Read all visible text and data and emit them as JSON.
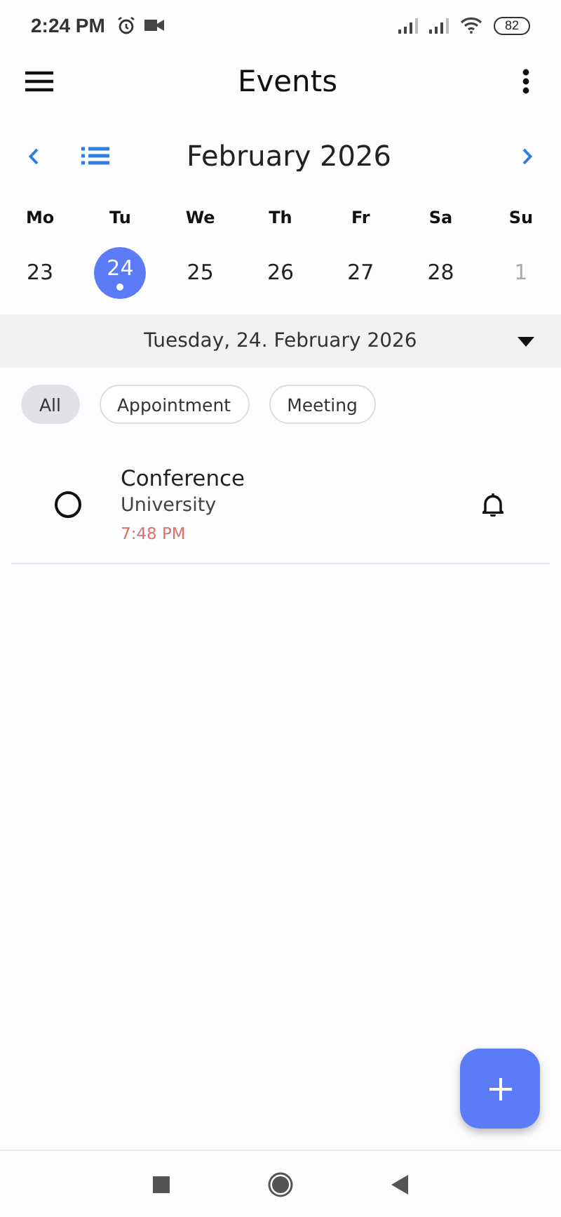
{
  "status_bar": {
    "time": "2:24 PM",
    "battery": "82"
  },
  "header": {
    "title": "Events"
  },
  "month": {
    "title": "February 2026"
  },
  "weekdays": [
    "Mo",
    "Tu",
    "We",
    "Th",
    "Fr",
    "Sa",
    "Su"
  ],
  "days": [
    {
      "label": "23",
      "selected": false,
      "muted": false,
      "has_event": false
    },
    {
      "label": "24",
      "selected": true,
      "muted": false,
      "has_event": true
    },
    {
      "label": "25",
      "selected": false,
      "muted": false,
      "has_event": false
    },
    {
      "label": "26",
      "selected": false,
      "muted": false,
      "has_event": false
    },
    {
      "label": "27",
      "selected": false,
      "muted": false,
      "has_event": false
    },
    {
      "label": "28",
      "selected": false,
      "muted": false,
      "has_event": false
    },
    {
      "label": "1",
      "selected": false,
      "muted": true,
      "has_event": false
    }
  ],
  "date_bar": {
    "label": "Tuesday, 24. February 2026"
  },
  "filters": [
    {
      "label": "All",
      "selected": true
    },
    {
      "label": "Appointment",
      "selected": false
    },
    {
      "label": "Meeting",
      "selected": false
    }
  ],
  "events": [
    {
      "title": "Conference",
      "location": "University",
      "time": "7:48 PM",
      "done": false,
      "reminder": true
    }
  ]
}
